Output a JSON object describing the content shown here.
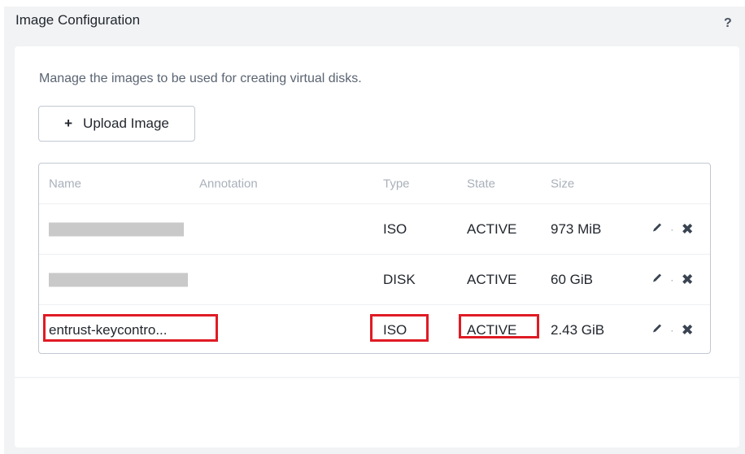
{
  "panel": {
    "title": "Image Configuration",
    "help_label": "?",
    "description": "Manage the images to be used for creating virtual disks.",
    "upload_button": {
      "icon": "plus-icon",
      "label": "Upload Image"
    }
  },
  "table": {
    "columns": [
      "Name",
      "Annotation",
      "Type",
      "State",
      "Size"
    ],
    "rows": [
      {
        "name": "",
        "name_redacted": true,
        "annotation": "",
        "type": "ISO",
        "state": "ACTIVE",
        "size": "973 MiB",
        "highlighted": false
      },
      {
        "name": "",
        "name_redacted": true,
        "annotation": "",
        "type": "DISK",
        "state": "ACTIVE",
        "size": "60 GiB",
        "highlighted": false
      },
      {
        "name": "entrust-keycontro...",
        "name_redacted": false,
        "annotation": "",
        "type": "ISO",
        "state": "ACTIVE",
        "size": "2.43 GiB",
        "highlighted": true
      }
    ],
    "row_actions": {
      "edit_icon": "pencil-icon",
      "separator": "·",
      "delete_icon": "close-icon",
      "delete_glyph": "✖"
    }
  },
  "colors": {
    "highlight": "#e01b24",
    "panel_bg": "#f2f3f5",
    "header_text": "#a9b0ba"
  }
}
